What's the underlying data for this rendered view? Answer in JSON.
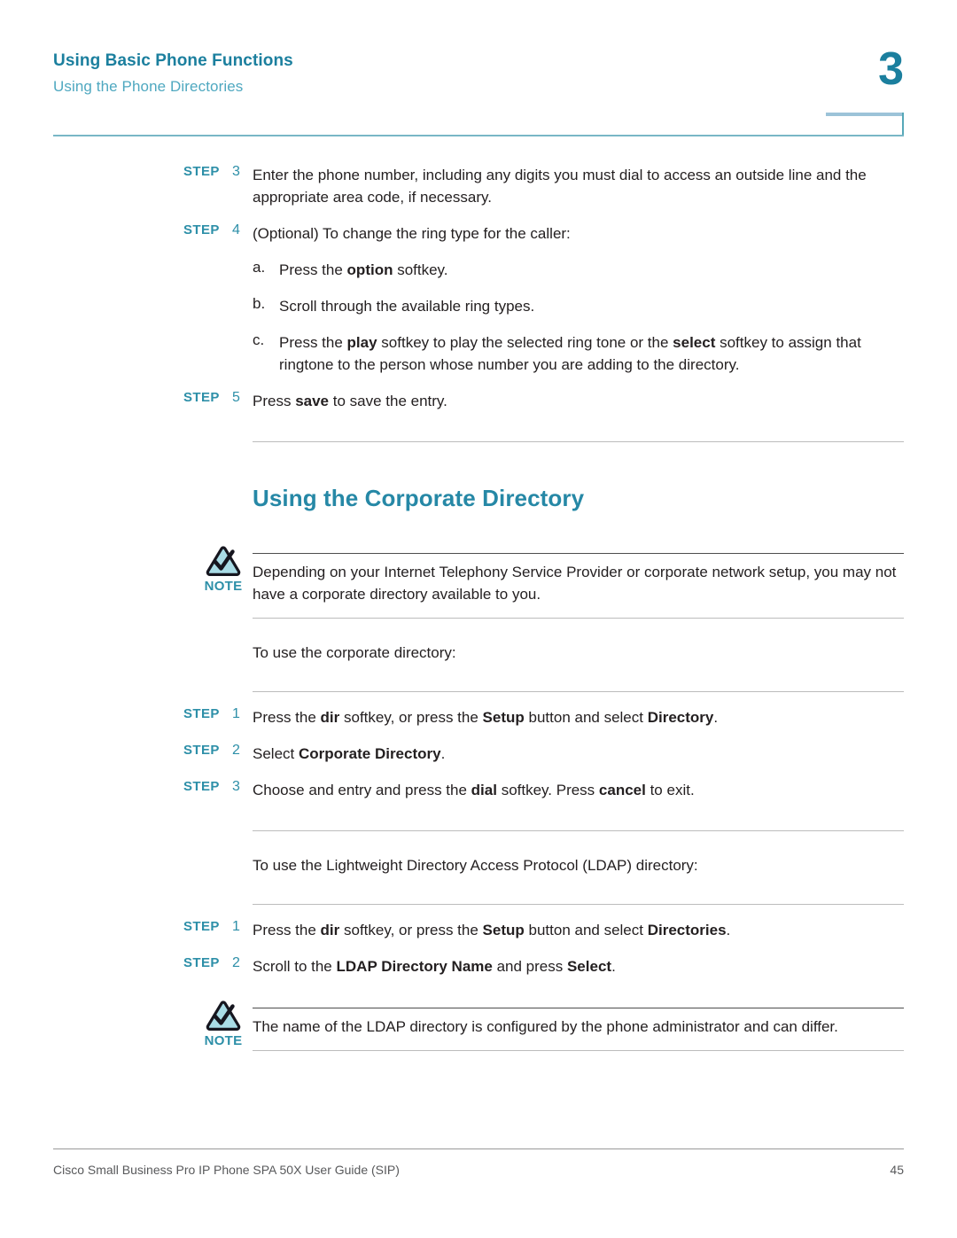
{
  "header": {
    "title": "Using Basic Phone Functions",
    "subtitle": "Using the Phone Directories",
    "chapter_number": "3",
    "accent_color": "#1b7f9e",
    "subtitle_color": "#4fa8c0",
    "rule_color": "#79b7c6"
  },
  "steps_top": [
    {
      "label": "STEP",
      "number": "3",
      "text_html": "Enter the phone number, including any digits you must dial to access an outside line and the appropriate area code, if necessary."
    },
    {
      "label": "STEP",
      "number": "4",
      "text_html": "(Optional) To change the ring type for the caller:"
    }
  ],
  "substeps": [
    {
      "marker": "a.",
      "text_html": "Press the <b>option</b> softkey."
    },
    {
      "marker": "b.",
      "text_html": "Scroll through the available ring types."
    },
    {
      "marker": "c.",
      "text_html": "Press the <b>play</b> softkey to play the selected ring tone or the <b>select</b> softkey to assign that ringtone to the person whose number you are adding to the directory."
    }
  ],
  "step_save": {
    "label": "STEP",
    "number": "5",
    "text_html": "Press <b>save</b> to save the entry."
  },
  "section": {
    "heading": "Using the Corporate Directory",
    "heading_color": "#2688a6"
  },
  "note_corporate": {
    "icon_name": "note-triangle-check-icon",
    "word": "NOTE",
    "word_color": "#2d8fa8",
    "icon_fill": "#a9dce6",
    "icon_stroke": "#1a1a2e",
    "text_html": "Depending on your Internet Telephony Service Provider or corporate network setup, you may not have a corporate directory available to you."
  },
  "intro_corporate": "To use the corporate directory:",
  "steps_corporate": [
    {
      "label": "STEP",
      "number": "1",
      "text_html": "Press the <b>dir</b> softkey, or press the <b>Setup</b> button and select <b>Directory</b>."
    },
    {
      "label": "STEP",
      "number": "2",
      "text_html": "Select <b>Corporate Directory</b>."
    },
    {
      "label": "STEP",
      "number": "3",
      "text_html": "Choose and entry and press the <b>dial</b> softkey. Press <b>cancel</b> to exit."
    }
  ],
  "intro_ldap": "To use the Lightweight Directory Access Protocol (LDAP) directory:",
  "steps_ldap": [
    {
      "label": "STEP",
      "number": "1",
      "text_html": "Press the <b>dir</b> softkey, or press the <b>Setup</b> button and select <b>Directories</b>."
    },
    {
      "label": "STEP",
      "number": "2",
      "text_html": "Scroll to the <b>LDAP Directory Name</b> and press <b>Select</b>."
    }
  ],
  "note_ldap": {
    "icon_name": "note-triangle-check-icon",
    "word": "NOTE",
    "text_html": "The name of the LDAP directory is configured by the phone administrator and can differ."
  },
  "footer": {
    "text": "Cisco Small Business Pro IP Phone SPA 50X User Guide (SIP)",
    "page_number": "45"
  }
}
